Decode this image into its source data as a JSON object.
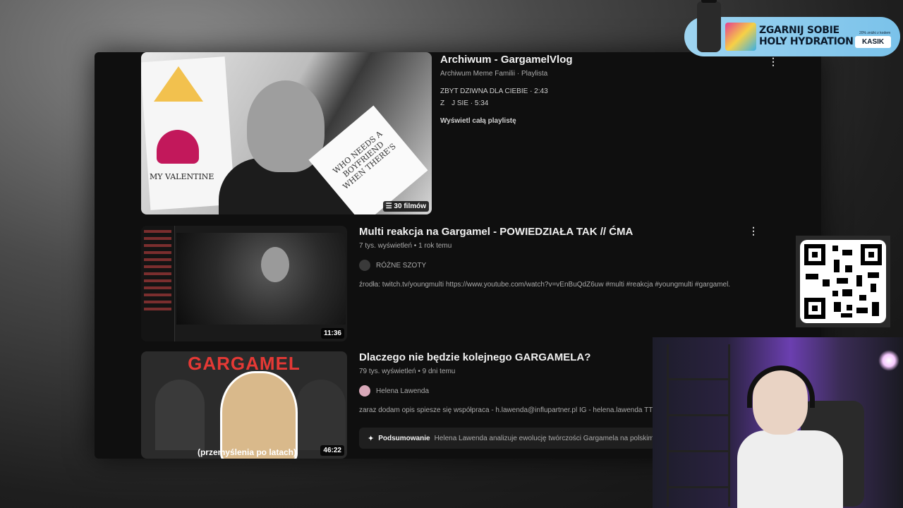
{
  "playlist": {
    "title": "Archiwum - GargamelVlog",
    "meta": "Archiwum Meme Familii · Playlista",
    "items": [
      "ZBYT DZIWNA DLA CIEBIE · 2:43",
      "Z  J SIE · 5:34"
    ],
    "view_all": "Wyświetl całą playlistę",
    "count_badge": "☰ 30 filmów",
    "thumb_text_valentine": "MY VALENTINE",
    "thumb_text_sticker": "WHO NEEDS A BOYFRIEND WHEN THERE'S"
  },
  "video1": {
    "title": "Multi reakcja na Gargamel - POWIEDZIAŁA TAK // ĆMA",
    "meta": "7 tys. wyświetleń • 1 rok temu",
    "channel": "RÓŻNE SZOTY",
    "description": "źrodła: twitch.tv/youngmulti https://www.youtube.com/watch?v=vEnBuQdZ6uw #multi #reakcja #youngmulti #gargamel.",
    "duration": "11:36"
  },
  "video2": {
    "title": "Dlaczego nie będzie kolejnego GARGAMELA?",
    "meta": "79 tys. wyświetleń • 9 dni temu",
    "channel": "Helena Lawenda",
    "description": "zaraz dodam opis spiesze się współpraca - h.lawenda@influpartner.pl IG - helena.lawenda TT- h",
    "duration": "46:22",
    "thumb_title": "GARGAMEL",
    "thumb_caption": "(przemyślenia po latach)",
    "summary_label": "Podsumowanie",
    "summary_text": "Helena Lawenda analizuje ewolucję twórczości Gargamela na polskim Y"
  },
  "icons": {
    "more": "⋮",
    "sparkle": "✦"
  },
  "ad": {
    "headline_1": "ZGARNIJ SOBIE",
    "headline_2": "HOLY HYDRATION",
    "fine_print": "20% zniżki z kodem",
    "code": "KASIK",
    "accent": "#9ed4f0"
  }
}
